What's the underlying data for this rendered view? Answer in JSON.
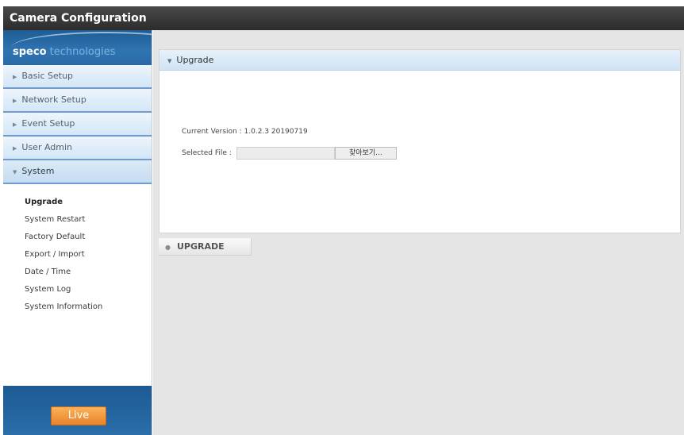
{
  "window": {
    "title": "Camera Configuration"
  },
  "logo": {
    "brand_strong": "speco",
    "brand_soft": "technologies"
  },
  "menu": {
    "items": [
      {
        "label": "Basic Setup",
        "icon": "chevron-right-icon"
      },
      {
        "label": "Network Setup",
        "icon": "chevron-right-icon"
      },
      {
        "label": "Event Setup",
        "icon": "chevron-right-icon"
      },
      {
        "label": "User Admin",
        "icon": "chevron-right-icon"
      },
      {
        "label": "System",
        "icon": "chevron-down-icon",
        "expanded": true
      }
    ],
    "system_subitems": [
      "Upgrade",
      "System Restart",
      "Factory Default",
      "Export / Import",
      "Date / Time",
      "System Log",
      "System Information"
    ],
    "selected_subitem": "Upgrade"
  },
  "live": {
    "label": "Live"
  },
  "panel": {
    "title": "Upgrade",
    "current_version_label": "Current Version :",
    "current_version_value": "1.0.2.3 20190719",
    "selected_file_label": "Selected File :",
    "selected_file_value": "",
    "browse_label": "찾아보기..."
  },
  "actions": {
    "upgrade_label": "UPGRADE"
  },
  "colors": {
    "title_bar": "#2c2c2c",
    "menu_bar": "#d3e6f6",
    "menu_border": "#6f9ccc",
    "brand_blue": "#2a6aa6",
    "live_orange": "#e8822a",
    "content_bg": "#e5e5e5"
  }
}
